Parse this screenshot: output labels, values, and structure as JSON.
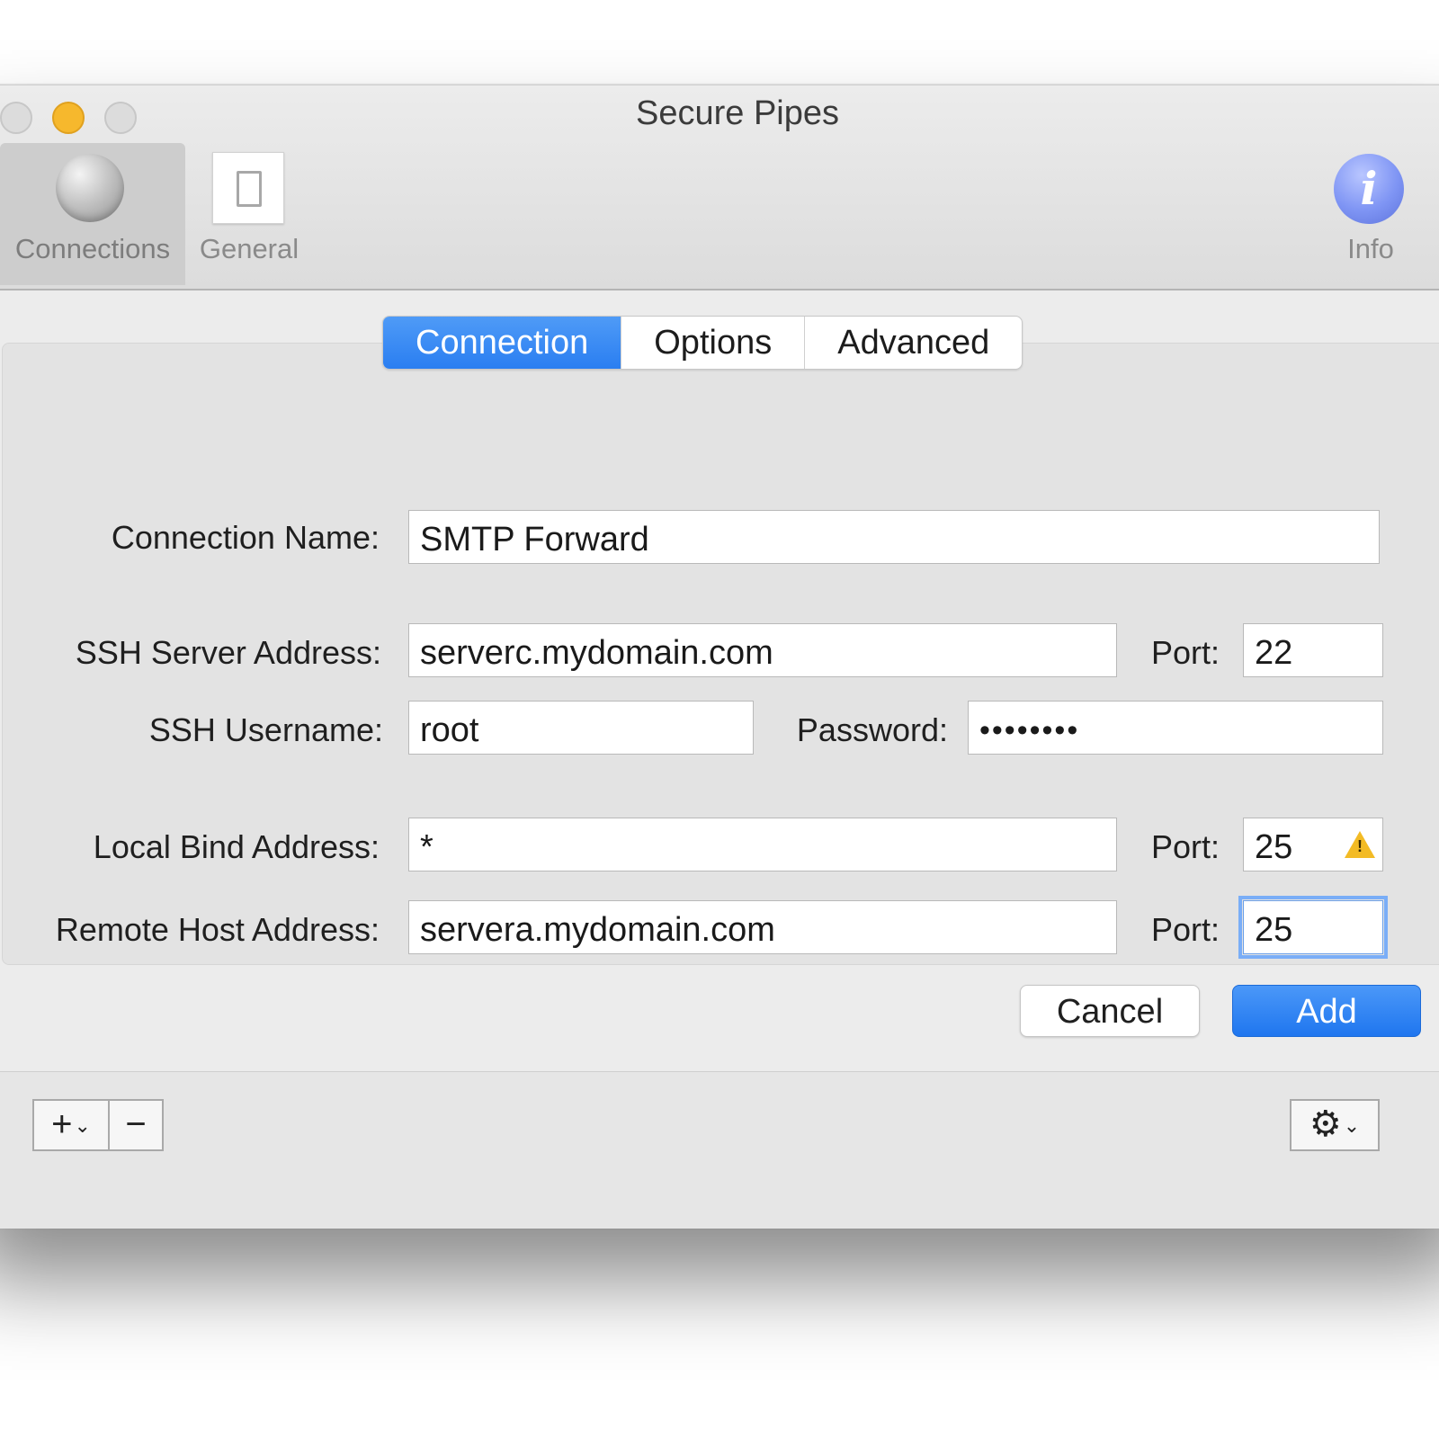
{
  "window": {
    "title": "Secure Pipes"
  },
  "toolbar": {
    "connections": "Connections",
    "general": "General",
    "info": "Info"
  },
  "tabs": [
    {
      "label": "Connection",
      "active": true
    },
    {
      "label": "Options",
      "active": false
    },
    {
      "label": "Advanced",
      "active": false
    }
  ],
  "form": {
    "connection_name_label": "Connection Name:",
    "connection_name_value": "SMTP Forward",
    "ssh_server_label": "SSH Server Address:",
    "ssh_server_value": "serverc.mydomain.com",
    "ssh_port_label": "Port:",
    "ssh_port_value": "22",
    "ssh_username_label": "SSH Username:",
    "ssh_username_value": "root",
    "password_label": "Password:",
    "password_value": "••••••••",
    "local_bind_label": "Local Bind Address:",
    "local_bind_value": "*",
    "local_port_label": "Port:",
    "local_port_value": "25",
    "remote_host_label": "Remote Host Address:",
    "remote_host_value": "servera.mydomain.com",
    "remote_port_label": "Port:",
    "remote_port_value": "25"
  },
  "buttons": {
    "cancel": "Cancel",
    "add": "Add"
  },
  "bottombar": {
    "add_symbol": "+",
    "remove_symbol": "−",
    "gear_symbol": "⚙",
    "chevron": "⌄"
  },
  "colors": {
    "accent": "#2a7ef1",
    "warning": "#f3bb25",
    "minimize": "#f6b82d"
  },
  "icons": [
    "globe-icon",
    "general-prefs-icon",
    "info-icon",
    "warning-icon",
    "gear-icon",
    "chevron-down-icon"
  ]
}
